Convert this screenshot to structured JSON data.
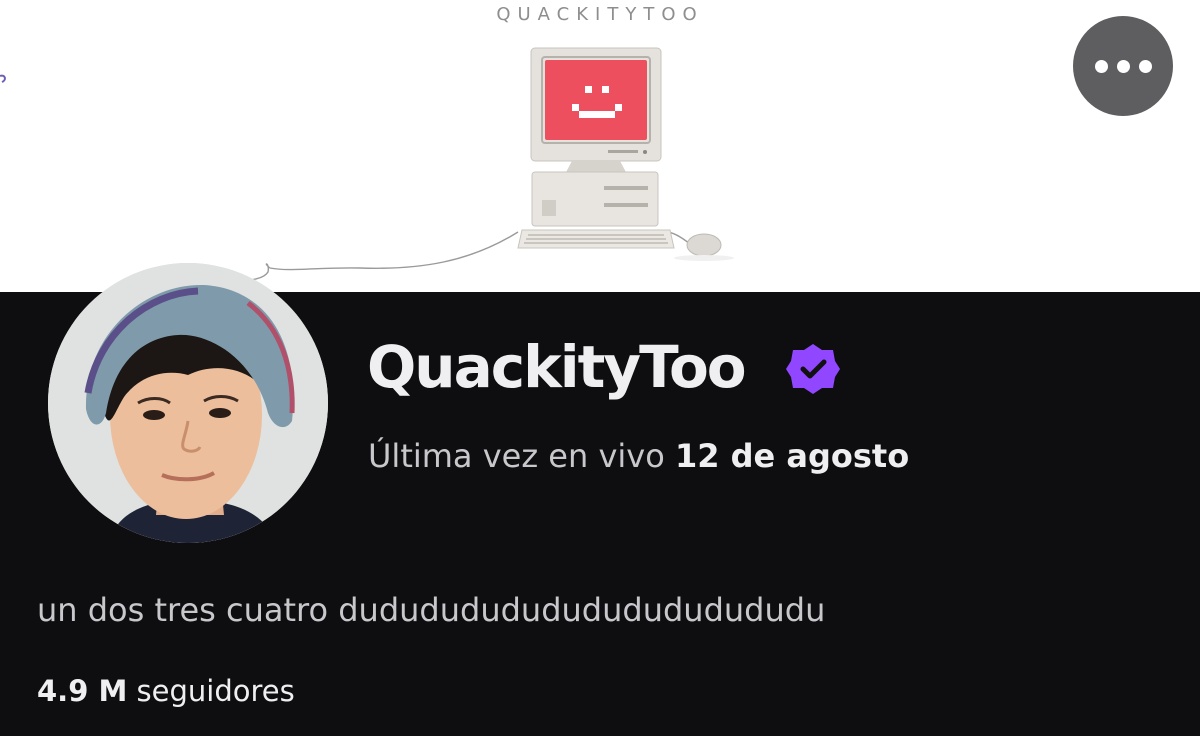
{
  "banner": {
    "title": "QUACKITYTOO"
  },
  "header": {
    "more_icon": "more-horizontal-icon"
  },
  "profile": {
    "channel_name": "QuackityToo",
    "verified_icon": "verified-badge-icon",
    "verified_color": "#9147ff",
    "last_live_prefix": "Última vez en vivo ",
    "last_live_date": "12 de agosto",
    "bio": "un dos tres cuatro dudududududududududududu",
    "followers_count": "4.9 M",
    "followers_label": " seguidores"
  },
  "colors": {
    "background": "#0e0e10",
    "text_primary": "#efeff1",
    "text_secondary": "#c8c8cc"
  }
}
